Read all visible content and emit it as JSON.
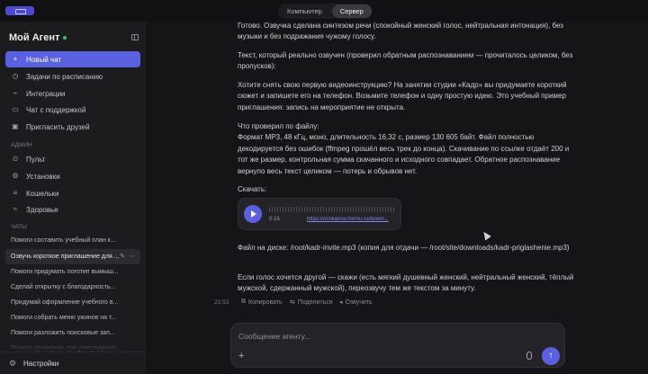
{
  "topbar": {
    "modes": [
      "Компьютер",
      "Сервер"
    ],
    "active_mode": "Сервер"
  },
  "sidebar": {
    "brand": "Мой Агент",
    "primary_items": [
      {
        "label": "Новый чат",
        "icon": "plus-icon"
      },
      {
        "label": "Задачи по расписанию",
        "icon": "clock-icon"
      },
      {
        "label": "Интеграции",
        "icon": "plug-icon"
      },
      {
        "label": "Чат с поддержкой",
        "icon": "chat-bubble-icon"
      },
      {
        "label": "Пригласить друзей",
        "icon": "gift-icon"
      }
    ],
    "admin_label": "АДМИН",
    "admin_items": [
      {
        "label": "Пульт",
        "icon": "dashboard-icon"
      },
      {
        "label": "Установки",
        "icon": "sliders-icon"
      },
      {
        "label": "Кошельки",
        "icon": "wallet-icon"
      },
      {
        "label": "Здоровье",
        "icon": "heart-icon"
      }
    ],
    "chats_label": "ЧАТЫ",
    "chats": [
      "Помоги составить учебный план к...",
      "Озвучь короткое приглашение для ...",
      "Помоги придумать логотип вымыш...",
      "Сделай открытку с благодарность...",
      "Придумай оформление учебного в...",
      "Помоги собрать меню ужинов на т...",
      "Помоги разложить поисковые зап...",
      "Помоги проверить три утверждения..."
    ],
    "settings_label": "Настройки"
  },
  "conversation": {
    "paragraphs": [
      "Готово. Озвучка сделана синтезом речи (спокойный женский голос, нейтральная интонация), без музыки и без подражания чужому голосу.",
      "Текст, который реально озвучен (проверил обратным распознаванием — прочиталось целиком, без пропусков):",
      "Хотите снять свою первую видеоинструкцию? На занятии студии «Кадр» вы придумаете короткий сюжет и запишете его на телефон. Возьмите телефон и одну простую идею. Это учебный пример приглашения: запись на мероприятие не открыта.",
      "Что проверил по файлу:\nФормат MP3, 48 кГц, моно, длительность 16,32 с, размер 130 605 байт. Файл полностью декодируется без ошибок (ffmpeg прошёл весь трек до конца). Скачивание по ссылке отдаёт 200 и тот же размер, контрольная сумма скачанного и исходного совпадает. Обратное распознавание вернуло весь текст целиком — потерь и обрывов нет.",
      "Скачать:"
    ],
    "audio": {
      "time": "0:16",
      "link": "https://ochkanov.mxmu.ru/downl..."
    },
    "after_paragraphs": [
      "Файл на диске: /root/kadr-invite.mp3 (копия для отдачи — /root/site/downloads/kadr-priglashenie.mp3)",
      "Если голос хочется другой — скажи (есть мягкий душевный женский, нейтральный женский, тёплый мужской, сдержанный мужской), переозвучу тем же текстом за минуту."
    ],
    "message_time": "22:53",
    "actions": [
      {
        "label": "Копировать",
        "icon": "copy-icon"
      },
      {
        "label": "Поделиться",
        "icon": "share-icon"
      },
      {
        "label": "Озвучить",
        "icon": "speaker-icon"
      }
    ]
  },
  "composer": {
    "placeholder": "Сообщение агенту..."
  },
  "colors": {
    "accent": "#5a61e0",
    "sidebar_bg": "#1c1c1f",
    "main_bg": "#151518",
    "online_dot": "#3fbf6f"
  }
}
